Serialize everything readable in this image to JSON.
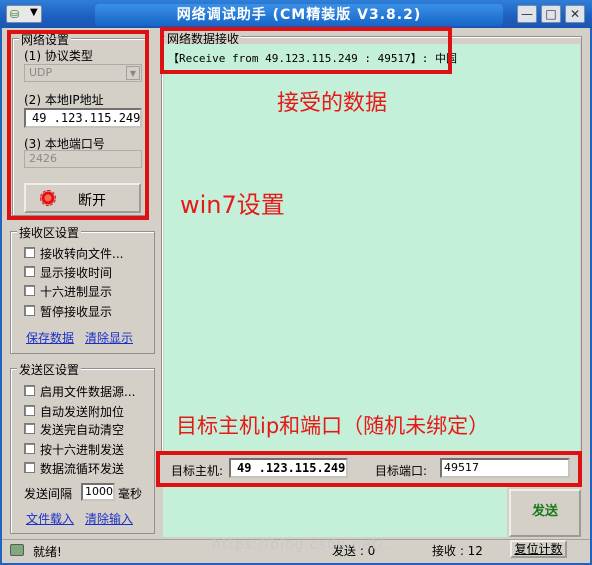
{
  "window": {
    "title": "网络调试助手 (CM精装版 V3.8.2)",
    "minimize": "—",
    "maximize": "□",
    "close": "✕"
  },
  "network_settings": {
    "title": "网络设置",
    "protocol_label": "(1) 协议类型",
    "protocol_value": "UDP",
    "local_ip_label": "(2) 本地IP地址",
    "local_ip_value": "49 .123.115.249",
    "local_port_label": "(3) 本地端口号",
    "local_port_value": "2426",
    "disconnect_button": "断开"
  },
  "receive_settings": {
    "title": "接收区设置",
    "options": [
      "接收转向文件...",
      "显示接收时间",
      "十六进制显示",
      "暂停接收显示"
    ],
    "save_link": "保存数据",
    "clear_link": "清除显示"
  },
  "send_settings": {
    "title": "发送区设置",
    "options": [
      "启用文件数据源...",
      "自动发送附加位",
      "发送完自动清空",
      "按十六进制发送",
      "数据流循环发送"
    ],
    "interval_label": "发送间隔",
    "interval_value": "1000",
    "interval_unit": "毫秒",
    "load_file_link": "文件载入",
    "clear_input_link": "清除输入"
  },
  "receive_area": {
    "title": "网络数据接收",
    "line": "【Receive from 49.123.115.249 : 49517】: 中国"
  },
  "target": {
    "host_label": "目标主机:",
    "host_value": "49 .123.115.249",
    "port_label": "目标端口:",
    "port_value": "49517"
  },
  "send_button": "发送",
  "status": {
    "text": "就绪!",
    "send_label": "发送 : 0",
    "recv_label": "接收 : 12",
    "reset_button": "复位计数"
  },
  "annotations": {
    "received": "接受的数据",
    "win7": "win7设置",
    "target": "目标主机ip和端口（随机未绑定）",
    "watermark": "https://blog.csdn.net/..."
  },
  "colors": {
    "title_blue": "#1d5fc0",
    "annotation_red": "#e81818",
    "receive_bg": "#c4efd8",
    "send_text_green": "#1a7a1a"
  },
  "icons": {
    "app": "network-app-icon",
    "disconnect": "red-light-icon",
    "status": "status-app-icon"
  }
}
